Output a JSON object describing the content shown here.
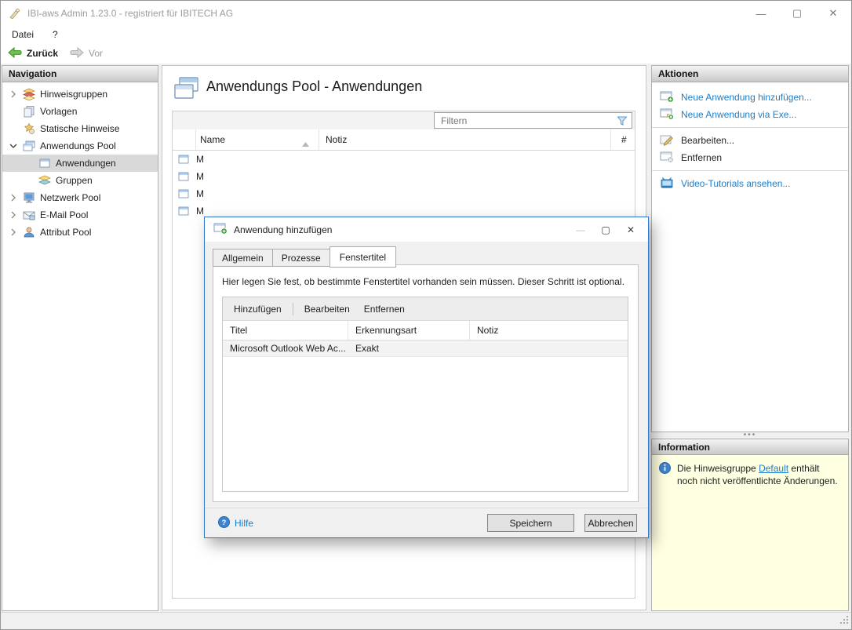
{
  "colors": {
    "accent_blue": "#1d7dc9",
    "info_bg": "#ffffe1",
    "dialog_border": "#2e75c3",
    "selection_gray": "#d9d9d9"
  },
  "window": {
    "title": "IBI-aws Admin 1.23.0 - registriert für IBITECH AG",
    "minimize": "—",
    "maximize": "▢",
    "close": "✕"
  },
  "menu": {
    "datei": "Datei",
    "help": "?"
  },
  "toolbar": {
    "back": "Zurück",
    "forward": "Vor"
  },
  "navigation": {
    "header": "Navigation",
    "items": [
      {
        "label": "Hinweisgruppen"
      },
      {
        "label": "Vorlagen"
      },
      {
        "label": "Statische Hinweise"
      },
      {
        "label": "Anwendungs Pool"
      },
      {
        "label": "Anwendungen"
      },
      {
        "label": "Gruppen"
      },
      {
        "label": "Netzwerk Pool"
      },
      {
        "label": "E-Mail Pool"
      },
      {
        "label": "Attribut Pool"
      }
    ]
  },
  "main": {
    "title": "Anwendungs Pool - Anwendungen",
    "filter_placeholder": "Filtern",
    "columns": {
      "name": "Name",
      "notiz": "Notiz",
      "count": "#"
    },
    "rows": [
      {
        "name": "M"
      },
      {
        "name": "M"
      },
      {
        "name": "M"
      },
      {
        "name": "M"
      }
    ]
  },
  "dialog": {
    "title": "Anwendung hinzufügen",
    "minimize": "—",
    "maximize": "▢",
    "close": "✕",
    "tabs": [
      {
        "label": "Allgemein"
      },
      {
        "label": "Prozesse"
      },
      {
        "label": "Fenstertitel"
      }
    ],
    "description": "Hier legen Sie fest, ob bestimmte Fenstertitel vorhanden sein müssen. Dieser Schritt ist optional.",
    "toolbar": {
      "add": "Hinzufügen",
      "edit": "Bearbeiten",
      "remove": "Entfernen"
    },
    "table": {
      "columns": {
        "titel": "Titel",
        "erkennungsart": "Erkennungsart",
        "notiz": "Notiz"
      },
      "rows": [
        {
          "titel": "Microsoft Outlook Web Ac...",
          "erkennungsart": "Exakt",
          "notiz": ""
        }
      ]
    },
    "footer": {
      "help": "Hilfe",
      "save": "Speichern",
      "cancel": "Abbrechen"
    }
  },
  "actions": {
    "header": "Aktionen",
    "items": [
      {
        "label": "Neue Anwendung hinzufügen..."
      },
      {
        "label": "Neue Anwendung via Exe..."
      },
      {
        "label": "Bearbeiten..."
      },
      {
        "label": "Entfernen"
      },
      {
        "label": "Video-Tutorials ansehen..."
      }
    ]
  },
  "information": {
    "header": "Information",
    "text_before": "Die Hinweisgruppe ",
    "link": "Default",
    "text_after": " enthält noch nicht veröffentlichte Änderungen."
  }
}
